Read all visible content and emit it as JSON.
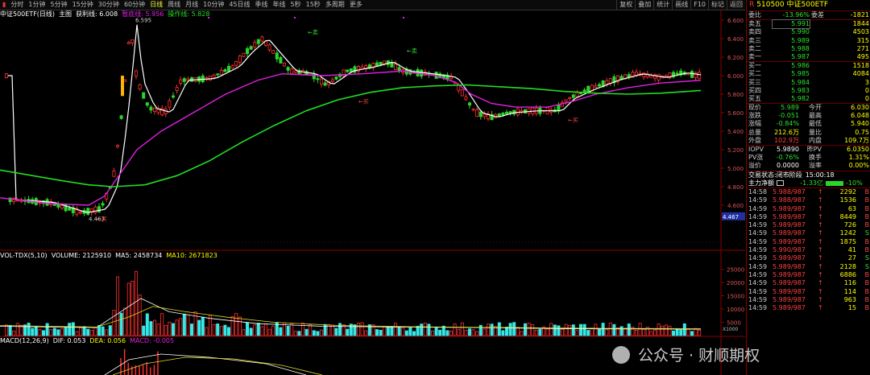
{
  "toolbar": {
    "periods": [
      "分时",
      "1分钟",
      "5分钟",
      "15分钟",
      "30分钟",
      "60分钟",
      "日线",
      "周线",
      "月线",
      "10分钟",
      "45日线",
      "季线",
      "年线",
      "5秒",
      "15秒",
      "多周期",
      "更多"
    ],
    "active_period": "日线",
    "right_buttons": [
      "复权",
      "叠加",
      "统计",
      "画线",
      "F10",
      "标记",
      "返回"
    ]
  },
  "chart_header": {
    "security": "中证500ETF(日线)",
    "main_label": "主图",
    "profit_line": "获利线: 6.008",
    "bottom_line": "暂底线: 5.956",
    "operate_line": "操作线: 5.828"
  },
  "price_axis": [
    "6.600",
    "6.400",
    "6.200",
    "6.000",
    "5.800",
    "5.600",
    "5.400",
    "5.200",
    "5.000",
    "4.800",
    "4.600"
  ],
  "current_price_marker": "4.467",
  "annotations": {
    "high_label": "6.595",
    "low_label": "4.463",
    "sell_labels": [
      "←卖",
      "←卖"
    ],
    "buy_labels": [
      "←买",
      "←买",
      "←买"
    ]
  },
  "volume_header": {
    "name": "VOL-TDX(5,10)",
    "volume": "VOLUME: 2125910",
    "ma5": "MA5: 2458734",
    "ma10": "MA10: 2671823"
  },
  "volume_axis": [
    "25000",
    "20000",
    "15000",
    "10000",
    "5000"
  ],
  "volume_unit": "X1000",
  "macd_header": {
    "name": "MACD(12,26,9)",
    "dif": "DIF: 0.053",
    "dea": "DEA: 0.056",
    "macd": "MACD: -0.005"
  },
  "panel": {
    "code": "510500",
    "name": "中证500ETF",
    "weibi_label": "委比",
    "weibi_value": "-13.96%",
    "weicha_label": "委差",
    "weicha_value": "-1821",
    "asks": [
      {
        "label": "卖五",
        "price": "5.991",
        "vol": "1844"
      },
      {
        "label": "卖四",
        "price": "5.990",
        "vol": "4503"
      },
      {
        "label": "卖三",
        "price": "5.989",
        "vol": "315"
      },
      {
        "label": "卖二",
        "price": "5.988",
        "vol": "271"
      },
      {
        "label": "卖一",
        "price": "5.987",
        "vol": "495"
      }
    ],
    "bids": [
      {
        "label": "买一",
        "price": "5.986",
        "vol": "1518"
      },
      {
        "label": "买二",
        "price": "5.985",
        "vol": "4084"
      },
      {
        "label": "买三",
        "price": "5.984",
        "vol": "3"
      },
      {
        "label": "买四",
        "price": "5.983",
        "vol": "0"
      },
      {
        "label": "买五",
        "price": "5.982",
        "vol": "0"
      }
    ],
    "quote": [
      {
        "l1": "现价",
        "v1": "5.989",
        "l2": "今开",
        "v2": "6.030"
      },
      {
        "l1": "涨跌",
        "v1": "-0.051",
        "l2": "最高",
        "v2": "6.048"
      },
      {
        "l1": "涨幅",
        "v1": "-0.84%",
        "l2": "最低",
        "v2": "5.940"
      },
      {
        "l1": "总量",
        "v1": "212.6万",
        "l2": "量比",
        "v2": "0.75"
      },
      {
        "l1": "外盘",
        "v1": "102.9万",
        "l2": "内盘",
        "v2": "109.7万"
      }
    ],
    "iopv": [
      {
        "l1": "IOPV",
        "v1": "5.9890",
        "l2": "昨PV",
        "v2": "6.0350"
      },
      {
        "l1": "PV涨",
        "v1": "-0.76%",
        "l2": "换手",
        "v2": "1.31%"
      },
      {
        "l1": "溢价",
        "v1": "0.0000",
        "l2": "溢率",
        "v2": "0.00%"
      }
    ],
    "status_label": "交易状态:",
    "status_value": "闭市阶段",
    "status_time": "15:00:18",
    "net_label": "主力净额",
    "net_value": "-1.33亿",
    "net_pct": "-10%",
    "trades": [
      {
        "t": "14:58",
        "p": "5.988/987",
        "v": "2292",
        "s": "B"
      },
      {
        "t": "14:59",
        "p": "5.988/987",
        "v": "1536",
        "s": "B"
      },
      {
        "t": "14:59",
        "p": "5.989/987",
        "v": "63",
        "s": "B"
      },
      {
        "t": "14:59",
        "p": "5.989/987",
        "v": "8449",
        "s": "B"
      },
      {
        "t": "14:59",
        "p": "5.989/987",
        "v": "726",
        "s": "B"
      },
      {
        "t": "14:59",
        "p": "5.989/987",
        "v": "1242",
        "s": "S"
      },
      {
        "t": "14:59",
        "p": "5.989/987",
        "v": "1875",
        "s": "B"
      },
      {
        "t": "14:59",
        "p": "5.990/987",
        "v": "41",
        "s": "B"
      },
      {
        "t": "14:59",
        "p": "5.989/987",
        "v": "27",
        "s": "S"
      },
      {
        "t": "14:59",
        "p": "5.989/987",
        "v": "2128",
        "s": "S"
      },
      {
        "t": "14:59",
        "p": "5.989/987",
        "v": "6886",
        "s": "B"
      },
      {
        "t": "14:59",
        "p": "5.989/987",
        "v": "116",
        "s": "B"
      },
      {
        "t": "14:59",
        "p": "5.989/987",
        "v": "114",
        "s": "B"
      },
      {
        "t": "14:59",
        "p": "5.989/987",
        "v": "963",
        "s": "B"
      },
      {
        "t": "14:59",
        "p": "5.989/987",
        "v": "15",
        "s": "B"
      }
    ]
  },
  "watermark": "公众号 · 财顺期权",
  "colors": {
    "up": "#ff3030",
    "down": "#2bd62b",
    "vol_up": "#ff3030",
    "vol_down": "#35e8e8",
    "ma_white": "#ffffff",
    "ma_magenta": "#e020e0",
    "ma_green": "#22dd22",
    "ma_yellow": "#dddd22"
  }
}
